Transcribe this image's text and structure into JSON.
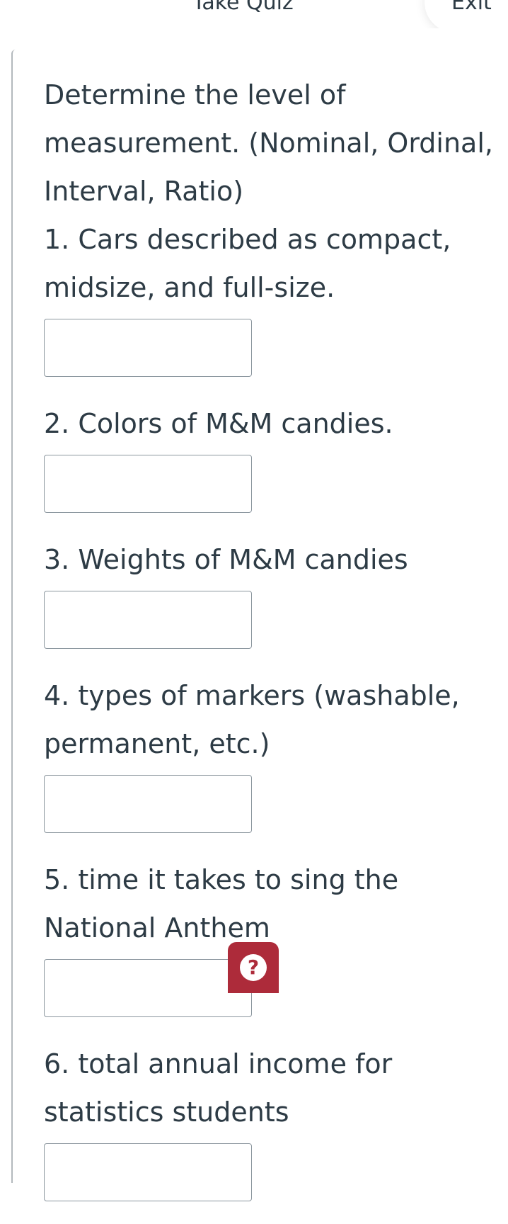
{
  "header": {
    "title": "Take Quiz",
    "exit_label": "Exit"
  },
  "quiz": {
    "prompt": "Determine the level of measurement. (Nominal, Ordinal, Interval, Ratio)",
    "questions": [
      {
        "text": "1. Cars described as compact, midsize, and full-size.",
        "answer": ""
      },
      {
        "text": "2. Colors of M&M candies.",
        "answer": ""
      },
      {
        "text": "3. Weights of M&M candies",
        "answer": ""
      },
      {
        "text": "4. types of markers (washable, permanent, etc.)",
        "answer": ""
      },
      {
        "text": "5. time it takes to sing the National Anthem",
        "answer": ""
      },
      {
        "text": "6. total annual income for statistics students",
        "answer": ""
      }
    ]
  },
  "help": {
    "icon": "question-mark-icon",
    "glyph": "?",
    "color": "#ad2b3a"
  }
}
